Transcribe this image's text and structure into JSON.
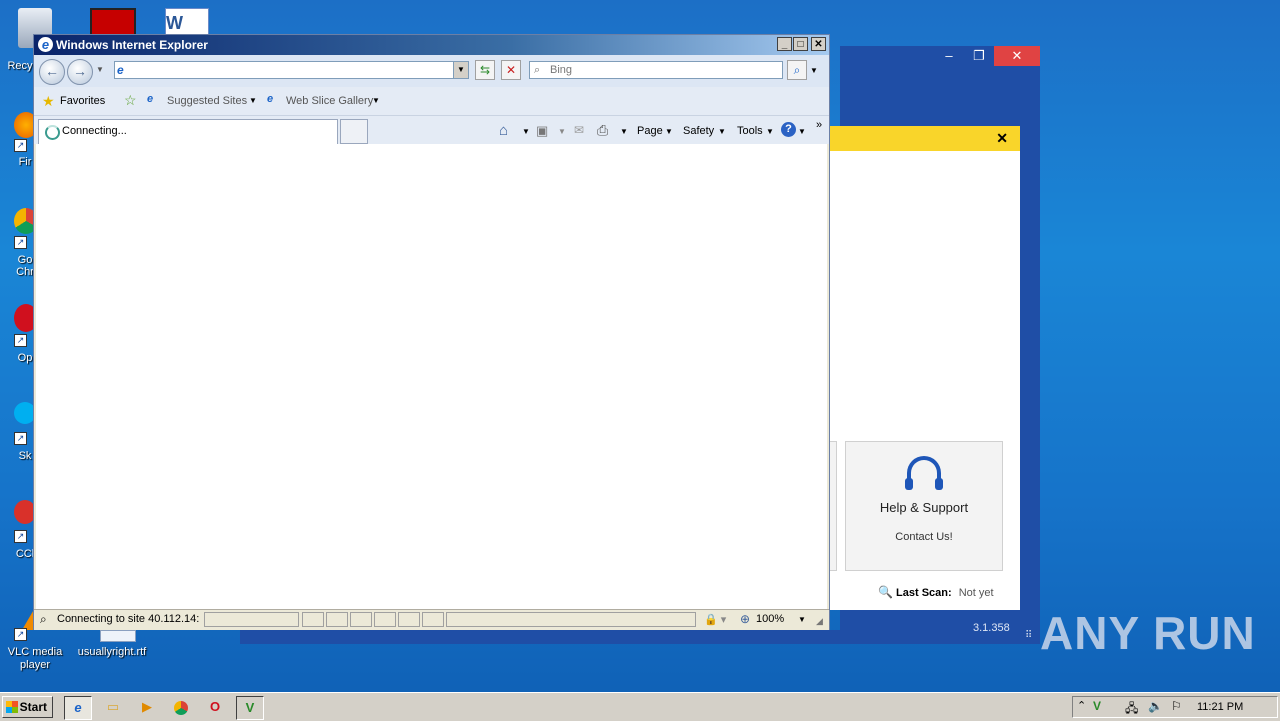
{
  "desktop": {
    "icons": [
      {
        "label": "Recy"
      },
      {
        "label": "Fir"
      },
      {
        "label": "Go\nChr"
      },
      {
        "label": "Op"
      },
      {
        "label": "Sk"
      },
      {
        "label": "CCl"
      },
      {
        "label": "VLC media\nplayer"
      },
      {
        "label": "usuallyright.rtf"
      }
    ]
  },
  "background_app": {
    "help_title": "Help & Support",
    "help_subtitle": "Contact Us!",
    "last_scan_label": "Last Scan:",
    "last_scan_value": "Not yet",
    "version": "3.1.358",
    "accent_color": "#f9d52a"
  },
  "ie": {
    "title": "Windows Internet Explorer",
    "search_placeholder": "Bing",
    "favorites": "Favorites",
    "suggested_sites": "Suggested Sites",
    "web_slice_gallery": "Web Slice Gallery",
    "tab_label": "Connecting...",
    "cmd_page": "Page",
    "cmd_safety": "Safety",
    "cmd_tools": "Tools",
    "status_text": "Connecting to site 40.112.14:",
    "zoom": "100%"
  },
  "taskbar": {
    "start": "Start",
    "clock": "11:21 PM"
  },
  "watermark": "ANY RUN"
}
